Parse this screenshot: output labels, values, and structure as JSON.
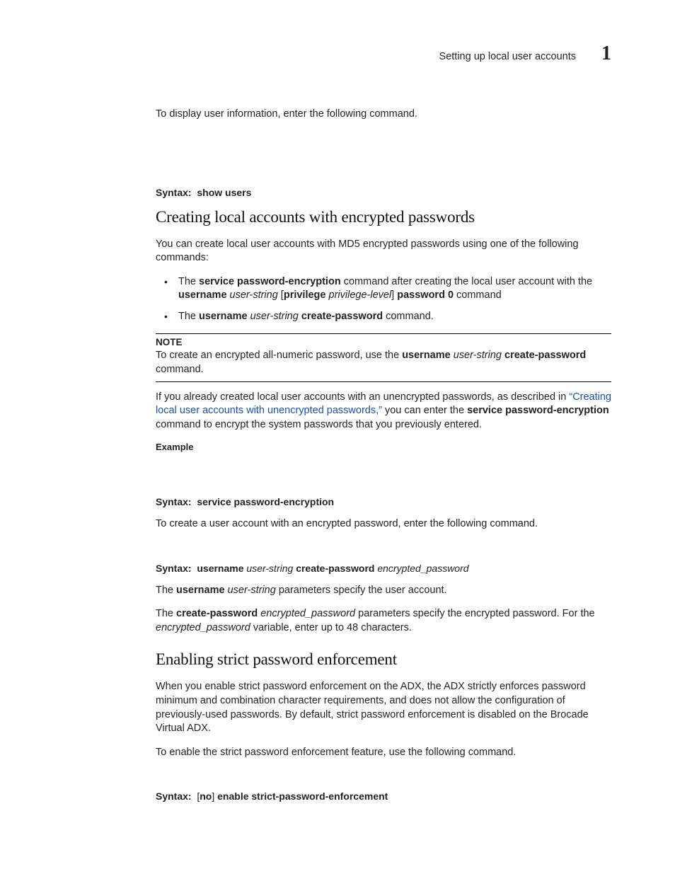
{
  "header": {
    "title": "Setting up local user accounts",
    "chapter_number": "1"
  },
  "intro": {
    "p1": "To display user information, enter the following command.",
    "syntax1_label": "Syntax:",
    "syntax1_body": "show users"
  },
  "sec1": {
    "heading": "Creating local accounts with encrypted passwords",
    "p1": "You can create local user accounts with MD5 encrypted passwords using one of the following commands:",
    "bullet1_pre": "The ",
    "bullet1_b1": "service password-encryption",
    "bullet1_mid": " command after creating the local user account with the ",
    "bullet1_b2": "username",
    "bullet1_sp": " ",
    "bullet1_i1": "user-string",
    "bullet1_br1": " [",
    "bullet1_b3": "privilege",
    "bullet1_sp2": " ",
    "bullet1_i2": "privilege-level",
    "bullet1_br2": "] ",
    "bullet1_b4": "password 0",
    "bullet1_tail": " command",
    "bullet2_pre": "The ",
    "bullet2_b1": "username",
    "bullet2_sp": " ",
    "bullet2_i1": "user-string",
    "bullet2_sp2": " ",
    "bullet2_b2": "create-password",
    "bullet2_tail": " command.",
    "note_label": "NOTE",
    "note_pre": "To create an encrypted all-numeric password, use the ",
    "note_b1": "username",
    "note_sp": " ",
    "note_i1": "user-string",
    "note_sp2": " ",
    "note_b2": "create-password",
    "note_tail": " command.",
    "p2_pre": "If you already created local user accounts with an unencrypted passwords, as described in ",
    "p2_link": "“Creating local user accounts with unencrypted passwords,”",
    "p2_mid": " you can enter the ",
    "p2_b1": "service password-encryption",
    "p2_tail": " command to encrypt the system passwords that you previously entered.",
    "example_label": "Example",
    "syntax2_label": "Syntax:",
    "syntax2_body": "service password-encryption",
    "p3": "To create a user account with an encrypted password, enter the following command.",
    "syntax3_label": "Syntax:",
    "syntax3_b1": "username",
    "syntax3_sp": " ",
    "syntax3_i1": "user-string",
    "syntax3_sp2": " ",
    "syntax3_b2": "create-password",
    "syntax3_sp3": " ",
    "syntax3_i2": "encrypted_password",
    "p4_pre": "The ",
    "p4_b1": "username",
    "p4_sp": " ",
    "p4_i1": "user-string",
    "p4_tail": " parameters specify the user account.",
    "p5_pre": "The ",
    "p5_b1": "create-password",
    "p5_sp": " ",
    "p5_i1": "encrypted_password",
    "p5_mid": " parameters specify the encrypted password. For the ",
    "p5_i2": "encrypted_password",
    "p5_tail": " variable, enter up to 48 characters."
  },
  "sec2": {
    "heading": "Enabling strict password enforcement",
    "p1": "When you enable strict password enforcement on the ADX, the ADX strictly enforces password minimum and combination character requirements, and does not allow the configuration of previously-used passwords. By default, strict password enforcement is disabled on the Brocade Virtual ADX.",
    "p2": "To enable the strict password enforcement feature, use the following command.",
    "syntax_label": "Syntax:",
    "syntax_pre": "[",
    "syntax_b1": "no",
    "syntax_mid": "] ",
    "syntax_b2": "enable strict-password-enforcement"
  }
}
